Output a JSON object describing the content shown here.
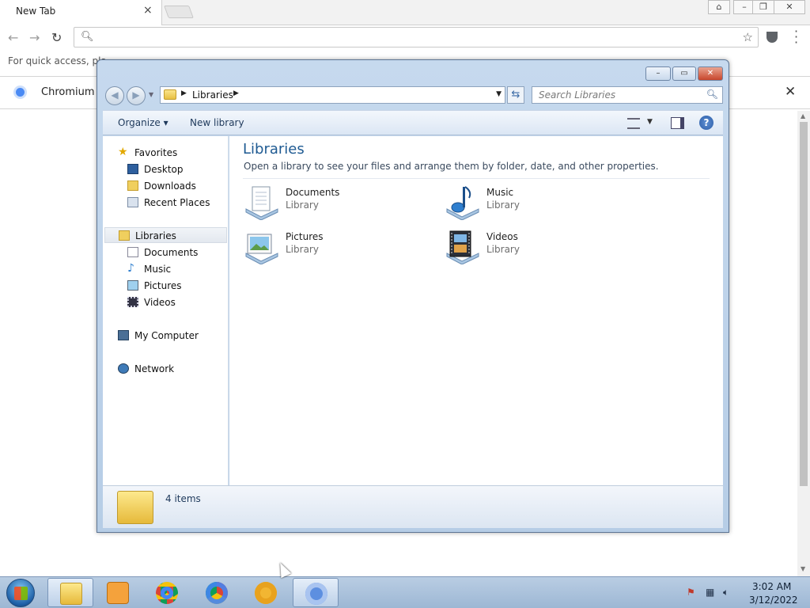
{
  "browser": {
    "tab_title": "New Tab",
    "tab_close": "×",
    "bookmark_hint": "For quick access, pla",
    "infobar_message": "Chromium is",
    "infobar_close": "✕",
    "window_buttons": [
      "⌂",
      "–",
      "❐",
      "✕"
    ]
  },
  "explorer": {
    "breadcrumb": "Libraries",
    "search_placeholder": "Search Libraries",
    "toolbar": {
      "organize_label": "Organize ▾",
      "new_library_label": "New library"
    },
    "caption_buttons": [
      "–",
      "▭",
      "✕"
    ],
    "nav": {
      "favorites_header": "Favorites",
      "favorites": [
        "Desktop",
        "Downloads",
        "Recent Places"
      ],
      "libraries_header": "Libraries",
      "libraries": [
        "Documents",
        "Music",
        "Pictures",
        "Videos"
      ],
      "computer": "My Computer",
      "network": "Network"
    },
    "content": {
      "heading": "Libraries",
      "subheading": "Open a library to see your files and arrange them by folder, date, and other properties.",
      "items": [
        {
          "name": "Documents",
          "type": "Library"
        },
        {
          "name": "Music",
          "type": "Library"
        },
        {
          "name": "Pictures",
          "type": "Library"
        },
        {
          "name": "Videos",
          "type": "Library"
        }
      ]
    },
    "status": {
      "count": "4 items"
    }
  },
  "taskbar": {
    "time": "3:02 AM",
    "date": "3/12/2022"
  },
  "colors": {
    "accent_heading": "#1e5a92",
    "taskbar": "#9db7d4"
  }
}
